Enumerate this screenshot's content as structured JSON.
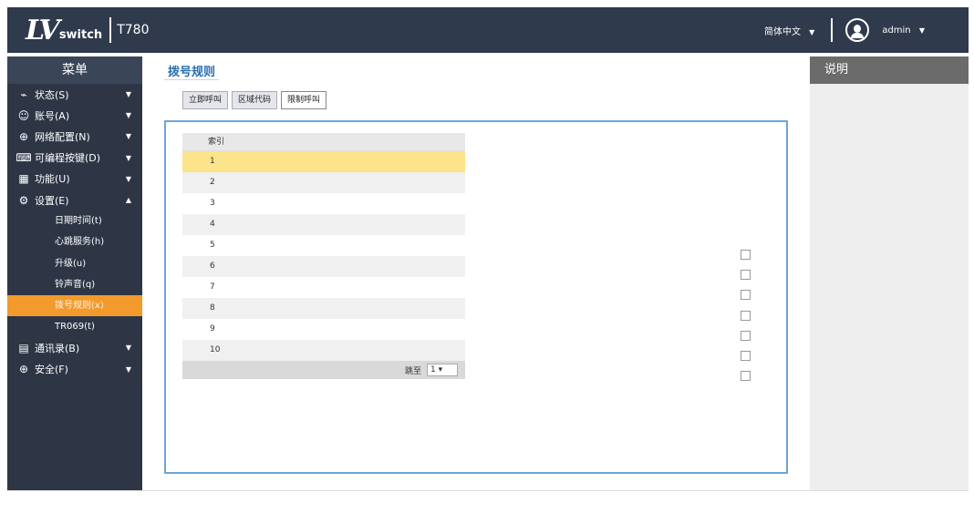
{
  "header": {
    "logo_mark": "LV",
    "logo_word": "switch",
    "model": "T780",
    "language": "简体中文",
    "user": "admin"
  },
  "sidebar": {
    "title": "菜单",
    "items": [
      {
        "label": "状态(S)",
        "icon": "status-icon"
      },
      {
        "label": "账号(A)",
        "icon": "account-icon"
      },
      {
        "label": "网络配置(N)",
        "icon": "network-icon"
      },
      {
        "label": "可编程按键(D)",
        "icon": "keyboard-icon"
      },
      {
        "label": "功能(U)",
        "icon": "grid-icon"
      },
      {
        "label": "设置(E)",
        "icon": "gear-icon"
      }
    ],
    "sub_items": [
      "日期时间(t)",
      "心跳服务(h)",
      "升级(u)",
      "铃声音(q)",
      "拨号规则(x)",
      "TR069(t)"
    ],
    "items_after": [
      {
        "label": "通讯录(B)",
        "icon": "book-icon"
      },
      {
        "label": "安全(F)",
        "icon": "shield-icon"
      }
    ]
  },
  "main": {
    "title": "拨号规则",
    "tabs": [
      "立即呼叫",
      "区域代码",
      "限制呼叫"
    ],
    "table": {
      "header_index": "索引",
      "rows": [
        "1",
        "2",
        "3",
        "4",
        "5",
        "6",
        "7",
        "8",
        "9",
        "10"
      ]
    },
    "pager": {
      "label": "跳至",
      "page": "1"
    }
  },
  "help": {
    "title": "说明"
  }
}
